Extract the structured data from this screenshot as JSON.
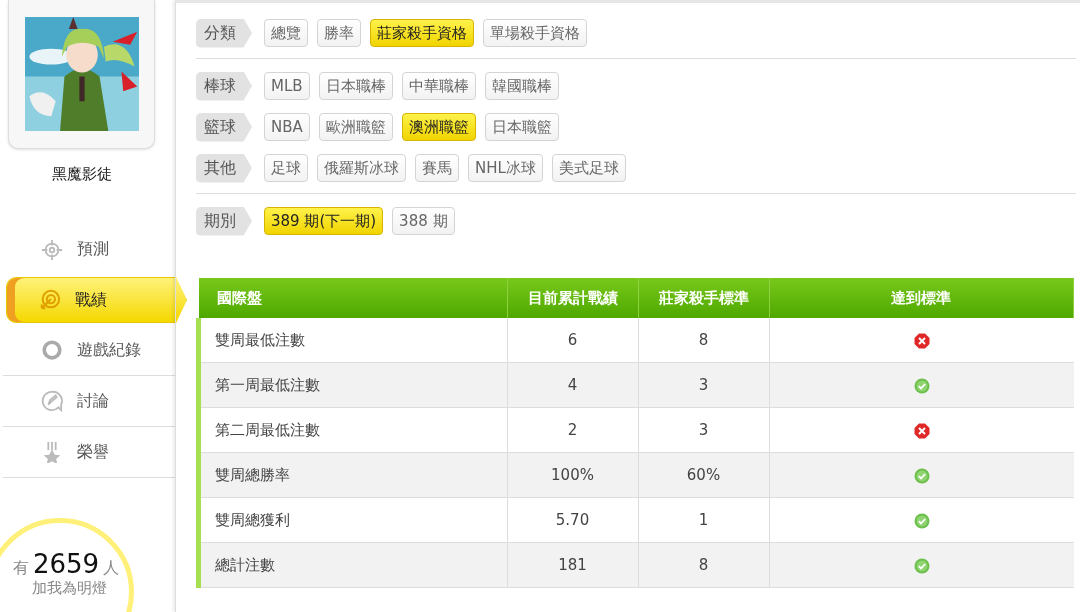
{
  "sidebar": {
    "username": "黑魔影徒",
    "nav": [
      {
        "label": "預測",
        "selected": false
      },
      {
        "label": "戰績",
        "selected": true
      },
      {
        "label": "遊戲紀錄",
        "selected": false
      },
      {
        "label": "討論",
        "selected": false
      },
      {
        "label": "榮譽",
        "selected": false
      }
    ],
    "fans": {
      "prefix": "有",
      "count": "2659",
      "suffix": "人",
      "caption": "加我為明燈"
    }
  },
  "filters": {
    "sections": [
      {
        "rows": [
          {
            "label": "分類",
            "options": [
              {
                "label": "總覽",
                "selected": false
              },
              {
                "label": "勝率",
                "selected": false
              },
              {
                "label": "莊家殺手資格",
                "selected": true
              },
              {
                "label": "單場殺手資格",
                "selected": false
              }
            ]
          }
        ]
      },
      {
        "rows": [
          {
            "label": "棒球",
            "options": [
              {
                "label": "MLB",
                "selected": false
              },
              {
                "label": "日本職棒",
                "selected": false
              },
              {
                "label": "中華職棒",
                "selected": false
              },
              {
                "label": "韓國職棒",
                "selected": false
              }
            ]
          },
          {
            "label": "籃球",
            "options": [
              {
                "label": "NBA",
                "selected": false
              },
              {
                "label": "歐洲職籃",
                "selected": false
              },
              {
                "label": "澳洲職籃",
                "selected": true
              },
              {
                "label": "日本職籃",
                "selected": false
              }
            ]
          },
          {
            "label": "其他",
            "options": [
              {
                "label": "足球",
                "selected": false
              },
              {
                "label": "俄羅斯冰球",
                "selected": false
              },
              {
                "label": "賽馬",
                "selected": false
              },
              {
                "label": "NHL冰球",
                "selected": false
              },
              {
                "label": "美式足球",
                "selected": false
              }
            ]
          }
        ]
      },
      {
        "rows": [
          {
            "label": "期別",
            "options": [
              {
                "label": "389 期(下一期)",
                "selected": true
              },
              {
                "label": "388 期",
                "selected": false
              }
            ]
          }
        ]
      }
    ]
  },
  "table": {
    "columns": [
      "國際盤",
      "目前累計戰績",
      "莊家殺手標準",
      "達到標準"
    ],
    "rows": [
      {
        "item": "雙周最低注數",
        "current": "6",
        "standard": "8",
        "met": false
      },
      {
        "item": "第一周最低注數",
        "current": "4",
        "standard": "3",
        "met": true
      },
      {
        "item": "第二周最低注數",
        "current": "2",
        "standard": "3",
        "met": false
      },
      {
        "item": "雙周總勝率",
        "current": "100%",
        "standard": "60%",
        "met": true
      },
      {
        "item": "雙周總獲利",
        "current": "5.70",
        "standard": "1",
        "met": true
      },
      {
        "item": "總計注數",
        "current": "181",
        "standard": "8",
        "met": true
      }
    ]
  }
}
